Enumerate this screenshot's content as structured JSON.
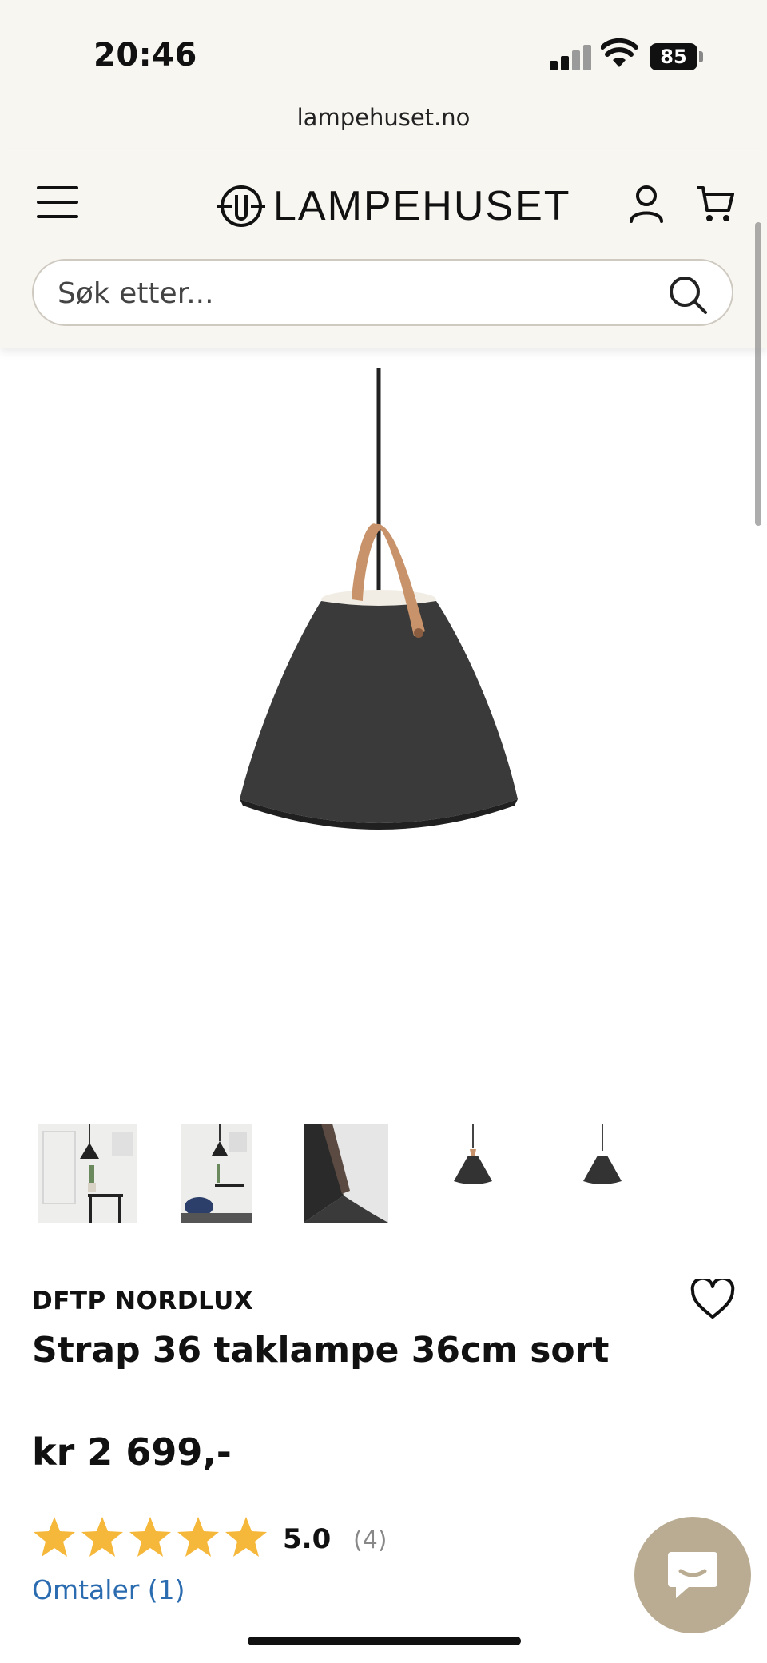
{
  "status_bar": {
    "time": "20:46",
    "battery": "85",
    "icons": [
      "signal-icon",
      "wifi-icon",
      "battery-icon"
    ]
  },
  "browser": {
    "url": "lampehuset.no"
  },
  "header": {
    "logo_text": "LAMPEHUSET",
    "icons": [
      "menu-icon",
      "logo-icon",
      "user-icon",
      "cart-icon"
    ]
  },
  "search": {
    "placeholder": "Søk etter...",
    "value": ""
  },
  "product": {
    "brand": "DFTP NORDLUX",
    "title": "Strap 36 taklampe 36cm sort",
    "price": "kr 2 699,-",
    "rating": "5.0",
    "rating_count": "(4)",
    "stars": 5,
    "reviews_link": "Omtaler (1)",
    "thumbnail_count": 5
  },
  "colors": {
    "header_bg": "#f8f6f1",
    "star": "#f5b83b",
    "link": "#2b6cb0",
    "chat_button": "#b9ac92"
  }
}
